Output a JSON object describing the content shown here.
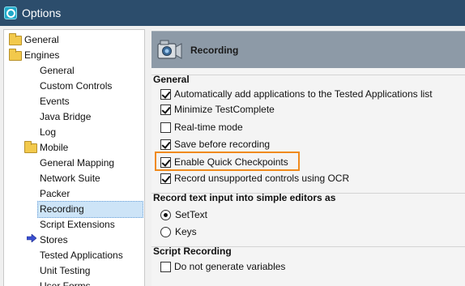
{
  "window": {
    "title": "Options"
  },
  "tree": {
    "items": [
      {
        "label": "General",
        "folder": true
      },
      {
        "label": "Engines",
        "folder": true
      },
      {
        "label": "General",
        "folder": false
      },
      {
        "label": "Custom Controls",
        "folder": false
      },
      {
        "label": "Events",
        "folder": false
      },
      {
        "label": "Java Bridge",
        "folder": false
      },
      {
        "label": "Log",
        "folder": false
      },
      {
        "label": "Mobile",
        "folder": true
      },
      {
        "label": "General Mapping",
        "folder": false
      },
      {
        "label": "Network Suite",
        "folder": false
      },
      {
        "label": "Packer",
        "folder": false
      },
      {
        "label": "Recording",
        "folder": false,
        "selected": true
      },
      {
        "label": "Script Extensions",
        "folder": false
      },
      {
        "label": "Stores",
        "folder": false
      },
      {
        "label": "Tested Applications",
        "folder": false
      },
      {
        "label": "Unit Testing",
        "folder": false
      },
      {
        "label": "User Forms",
        "folder": false
      }
    ]
  },
  "panel": {
    "banner_title": "Recording",
    "general": {
      "title": "General",
      "options": [
        {
          "label": "Automatically add applications to the Tested Applications list",
          "checked": true
        },
        {
          "label": "Minimize TestComplete",
          "checked": true
        },
        {
          "label": "Real-time mode",
          "checked": false
        },
        {
          "label": "Save before recording",
          "checked": true
        },
        {
          "label": "Enable Quick Checkpoints",
          "checked": true
        },
        {
          "label": "Record unsupported controls using OCR",
          "checked": true
        }
      ]
    },
    "text_input": {
      "title": "Record text input into simple editors as",
      "options": [
        {
          "label": "SetText",
          "checked": true
        },
        {
          "label": "Keys",
          "checked": false
        }
      ]
    },
    "script_recording": {
      "title": "Script Recording",
      "options": [
        {
          "label": "Do not generate variables",
          "checked": false
        }
      ]
    }
  },
  "colors": {
    "titlebar": "#2c4d6c",
    "banner": "#8d9aa7",
    "highlight": "#f08a1c",
    "selection": "#cde4f7"
  }
}
